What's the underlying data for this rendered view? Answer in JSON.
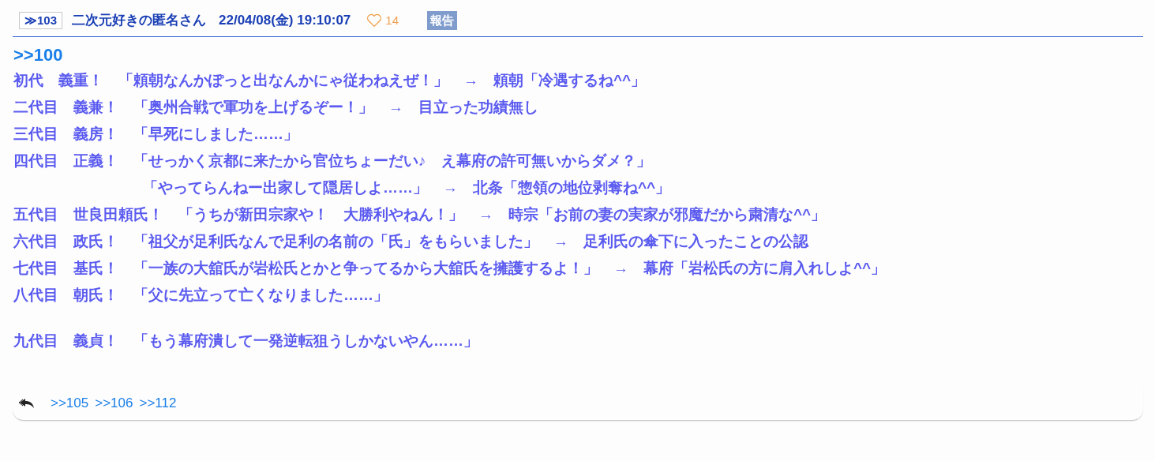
{
  "post": {
    "number": "≫103",
    "author": "二次元好きの匿名さん",
    "datetime": "22/04/08(金) 19:10:07",
    "likes": "14",
    "report": "報告"
  },
  "body": {
    "anchor": ">>100",
    "lines": [
      {
        "kind": "line",
        "text": "初代　義重！　「頼朝なんかぽっと出なんかにゃ従わねえぜ！」　→　頼朝「冷遇するね^^」"
      },
      {
        "kind": "line",
        "text": "二代目　義兼！　「奥州合戦で軍功を上げるぞー！」　→　目立った功績無し"
      },
      {
        "kind": "line",
        "text": "三代目　義房！　「早死にしました……」"
      },
      {
        "kind": "line",
        "text": "四代目　正義！　「せっかく京都に来たから官位ちょーだい♪　え幕府の許可無いからダメ？」"
      },
      {
        "kind": "continuation",
        "text": "「やってらんねー出家して隠居しよ……」　→　北条「惣領の地位剥奪ね^^」"
      },
      {
        "kind": "line",
        "text": "五代目　世良田頼氏！　「うちが新田宗家や！　大勝利やねん！」　→　時宗「お前の妻の実家が邪魔だから粛清な^^」"
      },
      {
        "kind": "line",
        "text": "六代目　政氏！　「祖父が足利氏なんで足利の名前の「氏」をもらいました」　→　足利氏の傘下に入ったことの公認"
      },
      {
        "kind": "line",
        "text": "七代目　基氏！　「一族の大舘氏が岩松氏とかと争ってるから大舘氏を擁護するよ！」　→　幕府「岩松氏の方に肩入れしよ^^」"
      },
      {
        "kind": "line",
        "text": "八代目　朝氏！　「父に先立って亡くなりました……」"
      },
      {
        "kind": "spaced",
        "text": "九代目　義貞！　「もう幕府潰して一発逆転狙うしかないやん……」"
      }
    ]
  },
  "replies": [
    ">>105",
    ">>106",
    ">>112"
  ]
}
